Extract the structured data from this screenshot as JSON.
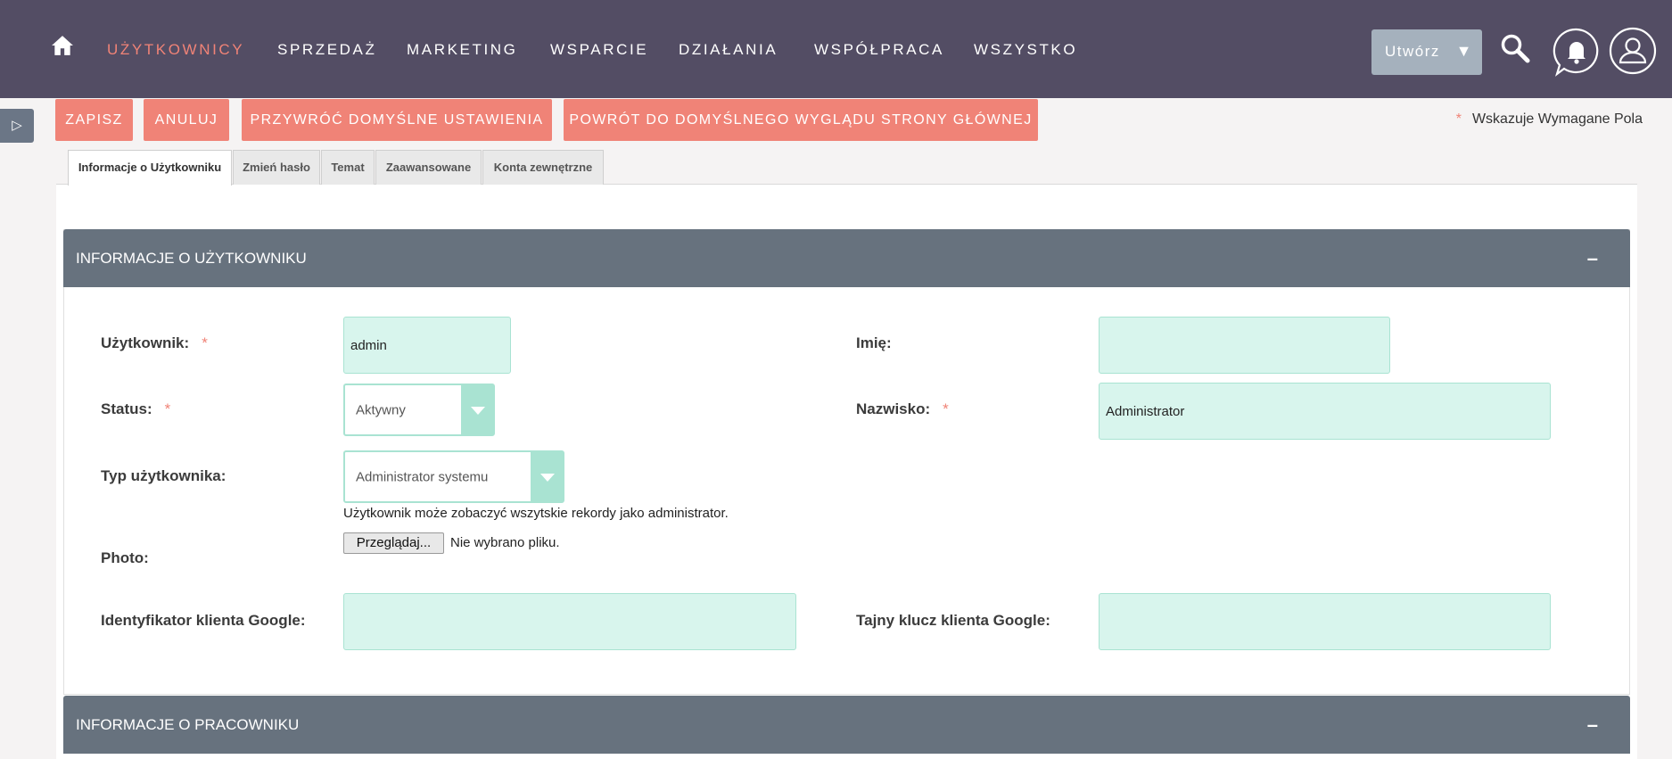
{
  "nav": {
    "items": [
      "UŻYTKOWNICY",
      "SPRZEDAŻ",
      "MARKETING",
      "WSPARCIE",
      "DZIAŁANIA",
      "WSPÓŁPRACA",
      "WSZYSTKO"
    ],
    "create_label": "Utwórz",
    "create_arrow": "▼"
  },
  "side_toggle": "▷",
  "actions": {
    "save": "ZAPISZ",
    "cancel": "ANULUJ",
    "restore_defaults": "PRZYWRÓĆ DOMYŚLNE USTAWIENIA",
    "restore_home": "POWRÓT DO DOMYŚLNEGO WYGLĄDU STRONY GŁÓWNEJ"
  },
  "required_note": {
    "star": "*",
    "text": "Wskazuje Wymagane Pola"
  },
  "tabs": [
    "Informacje o Użytkowniku",
    "Zmień hasło",
    "Temat",
    "Zaawansowane",
    "Konta zewnętrzne"
  ],
  "panel1": {
    "title": "INFORMACJE O UŻYTKOWNIKU",
    "collapse": "–",
    "username_label": "Użytkownik:",
    "username_value": "admin",
    "status_label": "Status:",
    "status_value": "Aktywny",
    "usertype_label": "Typ użytkownika:",
    "usertype_value": "Administrator systemu",
    "usertype_help": "Użytkownik może zobaczyć wszytskie rekordy jako administrator.",
    "photo_label": "Photo:",
    "photo_button": "Przeglądaj...",
    "photo_none": "Nie wybrano pliku.",
    "google_id_label": "Identyfikator klienta Google:",
    "google_id_value": "",
    "firstname_label": "Imię:",
    "firstname_value": "",
    "lastname_label": "Nazwisko:",
    "lastname_value": "Administrator",
    "google_secret_label": "Tajny klucz klienta Google:",
    "google_secret_value": "",
    "required_star": "*"
  },
  "panel2": {
    "title": "INFORMACJE O PRACOWNIKU",
    "collapse": "–"
  },
  "colors": {
    "nav_bg": "#534d64",
    "accent": "#f08377",
    "panel_header": "#67727e",
    "field_bg": "#d8f5ed",
    "field_border": "#a9e3d2"
  }
}
